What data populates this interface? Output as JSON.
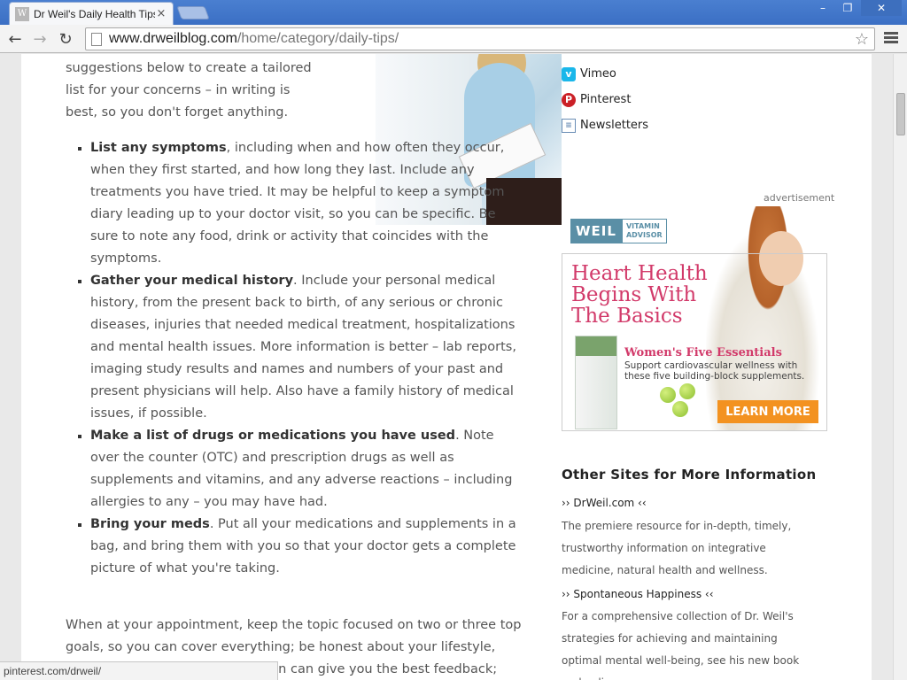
{
  "browser": {
    "tab_title": "Dr Weil's Daily Health Tips",
    "tab_close": "×",
    "url_host": "www.drweilblog.com",
    "url_path": "/home/category/daily-tips/",
    "status_url": "pinterest.com/drweil/",
    "win_min": "–",
    "win_max": "❐",
    "win_close": "✕",
    "back": "←",
    "forward": "→",
    "reload": "↻",
    "star": "☆"
  },
  "article": {
    "intro": "suggestions below to create a tailored list for your concerns – in writing is best, so you don't forget anything.",
    "items": [
      {
        "lead": "List any symptoms",
        "text": ", including when and how often they occur, when they first started, and how long they last. Include any treatments you have tried. It may be helpful to keep a symptom diary leading up to your doctor visit, so you can be specific. Be sure to note any food, drink or activity that coincides with the symptoms."
      },
      {
        "lead": "Gather your medical history",
        "text": ". Include your personal medical history, from the present back to birth, of any serious or chronic diseases, injuries that needed medical treatment, hospitalizations and mental health issues. More information is better – lab reports, imaging study results and names and numbers of your past and present physicians will help. Also have a family history of medical issues, if possible."
      },
      {
        "lead": "Make a list of drugs or medications you have used",
        "text": ". Note over the counter (OTC) and prescription drugs as well as supplements and vitamins, and any adverse reactions – including allergies to any – you may have had."
      },
      {
        "lead": "Bring your meds",
        "text": ". Put all your medications and supplements in a bag, and bring them with you so that your doctor gets a complete picture of what you're taking."
      }
    ],
    "after": "When at your appointment, keep the topic focused on two or three top goals, so you can cover everything; be honest about your lifestyle, aches and pains so your physician can give you the best feedback;"
  },
  "sidebar": {
    "social": [
      {
        "label": "Vimeo",
        "icon": "vimeo-icon",
        "glyph": "v"
      },
      {
        "label": "Pinterest",
        "icon": "pinterest-icon",
        "glyph": "P"
      },
      {
        "label": "Newsletters",
        "icon": "newsletter-icon",
        "glyph": "≡"
      }
    ],
    "ad_label": "advertisement",
    "ad": {
      "logo_main": "WEIL",
      "logo_sub1": "VITAMIN",
      "logo_sub2": "ADVISOR",
      "headline": "Heart Health Begins With The Basics",
      "sub": "Women's Five Essentials",
      "subtext": "Support cardiovascular wellness with these five building-block supplements.",
      "cta": "LEARN MORE"
    },
    "other_title": "Other Sites for More Information",
    "sites": [
      {
        "name": "›› DrWeil.com ‹‹",
        "desc": "The premiere resource for in-depth, timely, trustworthy information on integrative medicine, natural health and wellness."
      },
      {
        "name": "›› Spontaneous Happiness ‹‹",
        "desc": "For a comprehensive collection of Dr. Weil's strategies for achieving and maintaining optimal mental well-being, see his new book and online program"
      }
    ]
  }
}
